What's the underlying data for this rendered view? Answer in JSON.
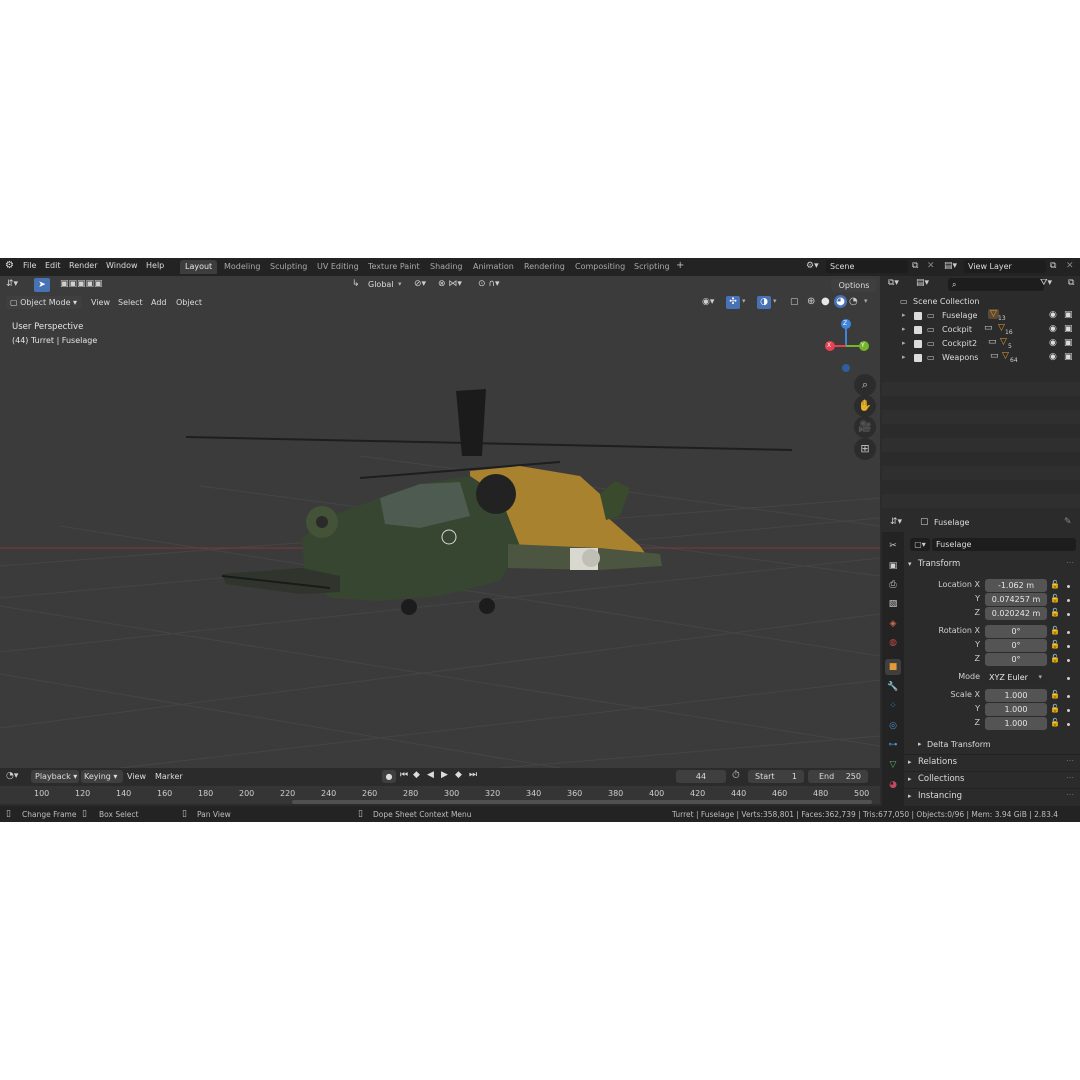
{
  "topbar": {
    "menus": [
      "File",
      "Edit",
      "Render",
      "Window",
      "Help"
    ],
    "workspaces": [
      "Layout",
      "Modeling",
      "Sculpting",
      "UV Editing",
      "Texture Paint",
      "Shading",
      "Animation",
      "Rendering",
      "Compositing",
      "Scripting"
    ],
    "add_tab": "+",
    "scene": "Scene",
    "view_layer": "View Layer"
  },
  "viewport": {
    "mode": "Object Mode",
    "menus": [
      "View",
      "Select",
      "Add",
      "Object"
    ],
    "orientation": "Global",
    "options": "Options",
    "perspective": "User Perspective",
    "context": "(44) Turret | Fuselage",
    "gizmo": {
      "z": "Z",
      "x": "X",
      "y": "Y"
    }
  },
  "outliner": {
    "root": "Scene Collection",
    "items": [
      {
        "name": "Fuselage",
        "count": "13"
      },
      {
        "name": "Cockpit",
        "count": "16"
      },
      {
        "name": "Cockpit2",
        "count": "5"
      },
      {
        "name": "Weapons",
        "count": "64"
      }
    ]
  },
  "properties": {
    "header_object": "Fuselage",
    "object_name": "Fuselage",
    "transform_title": "Transform",
    "location": {
      "label_x": "Location X",
      "label_y": "Y",
      "label_z": "Z",
      "x": "-1.062 m",
      "y": "0.074257 m",
      "z": "0.020242 m"
    },
    "rotation": {
      "label_x": "Rotation X",
      "label_y": "Y",
      "label_z": "Z",
      "x": "0°",
      "y": "0°",
      "z": "0°"
    },
    "mode_label": "Mode",
    "mode_value": "XYZ Euler",
    "scale": {
      "label_x": "Scale X",
      "label_y": "Y",
      "label_z": "Z",
      "x": "1.000",
      "y": "1.000",
      "z": "1.000"
    },
    "delta_transform": "Delta Transform",
    "relations": "Relations",
    "collections": "Collections",
    "instancing": "Instancing"
  },
  "timeline": {
    "menus": [
      "Playback",
      "Keying",
      "View",
      "Marker"
    ],
    "current_frame": "44",
    "start_label": "Start",
    "start": "1",
    "end_label": "End",
    "end": "250",
    "ticks": [
      "100",
      "120",
      "140",
      "160",
      "180",
      "200",
      "220",
      "240",
      "260",
      "280",
      "300",
      "320",
      "340",
      "360",
      "380",
      "400",
      "420",
      "440",
      "460",
      "480",
      "500"
    ]
  },
  "statusbar": {
    "change_frame": "Change Frame",
    "box_select": "Box Select",
    "pan_view": "Pan View",
    "context_menu": "Dope Sheet Context Menu",
    "stats": "Turret | Fuselage | Verts:358,801 | Faces:362,739 | Tris:677,050 | Objects:0/96 | Mem: 3.94 GiB | 2.83.4"
  },
  "colors": {
    "accent_blue": "#4772b3",
    "axis_x": "#e84050",
    "axis_y": "#75b52a",
    "axis_z": "#3f84db",
    "orange": "#e69a36",
    "heli_green": "#3c4a2e",
    "heli_yellow": "#c89a3a"
  }
}
